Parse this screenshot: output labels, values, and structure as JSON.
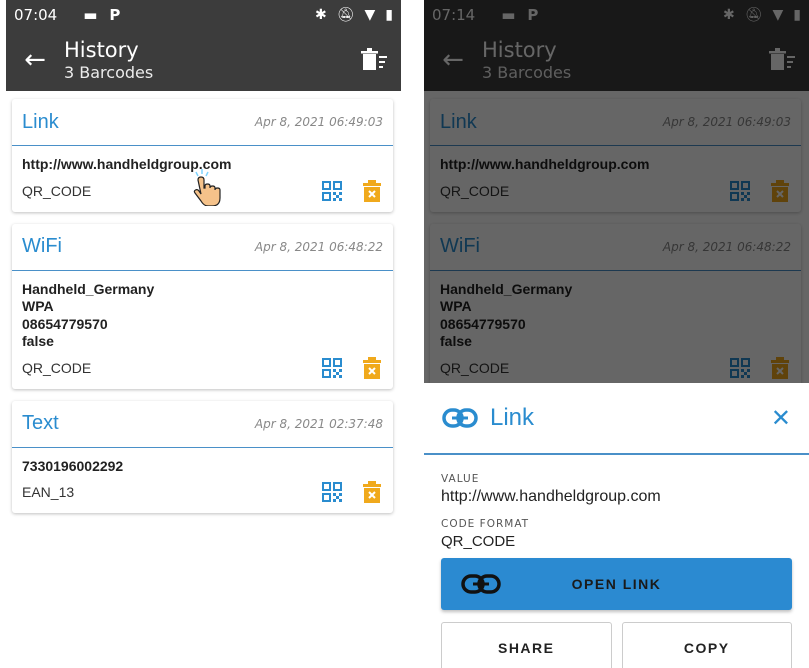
{
  "colors": {
    "appbar": "#3c3c3c",
    "accent": "#2a8ccf",
    "trash": "#f0a91c",
    "qr": "#2a8ccf",
    "primary_button": "#2b8ad1"
  },
  "left": {
    "status": {
      "time": "07:04",
      "p_label": "P"
    },
    "header": {
      "title": "History",
      "subtitle": "3 Barcodes"
    },
    "cards": [
      {
        "type": "Link",
        "date": "Apr 8, 2021 06:49:03",
        "lines": [
          "http://www.handheldgroup.com"
        ],
        "format": "QR_CODE"
      },
      {
        "type": "WiFi",
        "date": "Apr 8, 2021 06:48:22",
        "lines": [
          "Handheld_Germany",
          "WPA",
          "08654779570",
          "false"
        ],
        "format": "QR_CODE"
      },
      {
        "type": "Text",
        "date": "Apr 8, 2021 02:37:48",
        "lines": [
          "7330196002292"
        ],
        "format": "EAN_13"
      }
    ]
  },
  "right": {
    "status": {
      "time": "07:14",
      "p_label": "P"
    },
    "header": {
      "title": "History",
      "subtitle": "3 Barcodes"
    },
    "cards": [
      {
        "type": "Link",
        "date": "Apr 8, 2021 06:49:03",
        "lines": [
          "http://www.handheldgroup.com"
        ],
        "format": "QR_CODE"
      },
      {
        "type": "WiFi",
        "date": "Apr 8, 2021 06:48:22",
        "lines": [
          "Handheld_Germany",
          "WPA",
          "08654779570",
          "false"
        ],
        "format": "QR_CODE"
      }
    ],
    "sheet": {
      "title": "Link",
      "close": "✕",
      "value_label": "VALUE",
      "value": "http://www.handheldgroup.com",
      "format_label": "CODE FORMAT",
      "format": "QR_CODE",
      "open_button": "OPEN LINK",
      "share_button": "SHARE",
      "copy_button": "COPY"
    }
  }
}
